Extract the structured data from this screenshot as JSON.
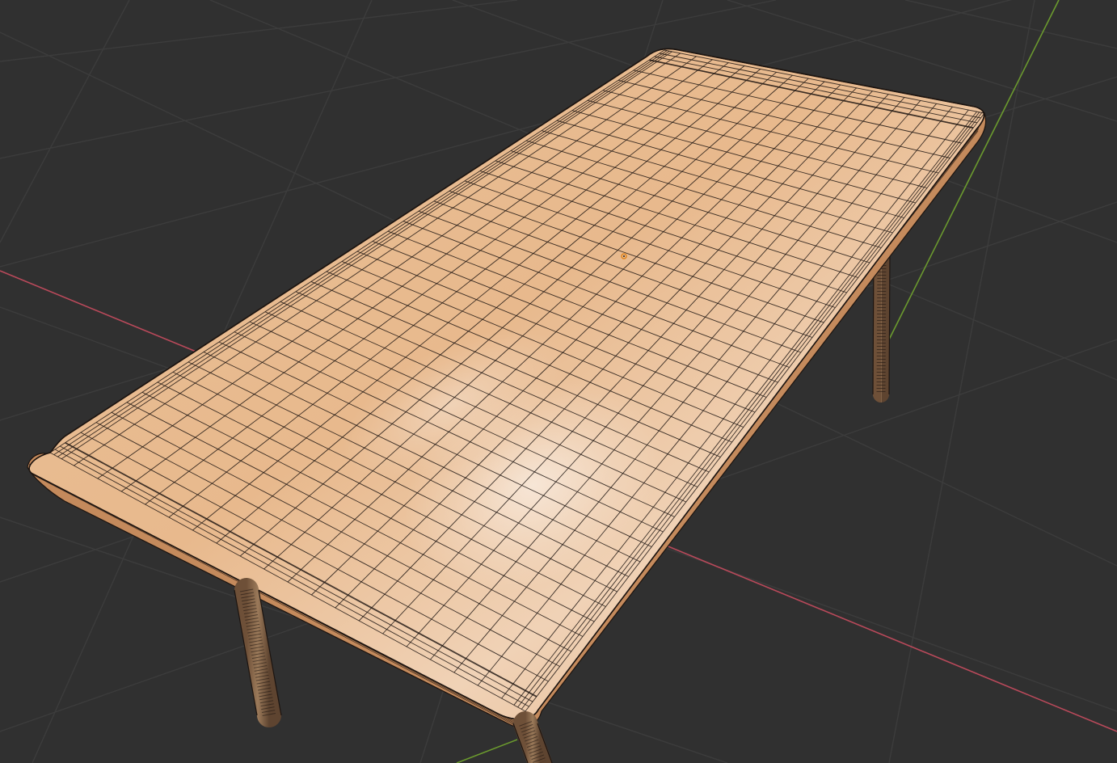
{
  "viewport": {
    "background_color": "#303030",
    "grid_line_color": "#3c3c3c",
    "x_axis_color": "#b8495a",
    "y_axis_color": "#6b9a2e",
    "object": {
      "kind": "bench",
      "display_mode": "wireframe-over-solid",
      "seat_color": "#e6b88a",
      "seat_edge_color": "#c48a5c",
      "wire_color": "#1c1410",
      "leg_color": "#8a6a4e",
      "seat_segments_long": 40,
      "seat_segments_wide": 20
    },
    "origin_marker": {
      "name": "object-origin",
      "color": "#e0841c"
    }
  }
}
